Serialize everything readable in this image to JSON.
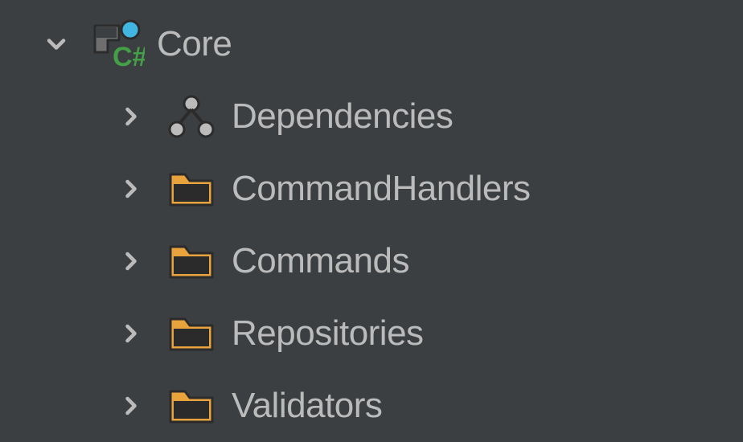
{
  "project": {
    "name": "Core",
    "expanded": true,
    "children": [
      {
        "icon": "dependencies",
        "label": "Dependencies",
        "expanded": false
      },
      {
        "icon": "folder",
        "label": "CommandHandlers",
        "expanded": false
      },
      {
        "icon": "folder",
        "label": "Commands",
        "expanded": false
      },
      {
        "icon": "folder",
        "label": "Repositories",
        "expanded": false
      },
      {
        "icon": "folder",
        "label": "Validators",
        "expanded": false
      }
    ]
  }
}
